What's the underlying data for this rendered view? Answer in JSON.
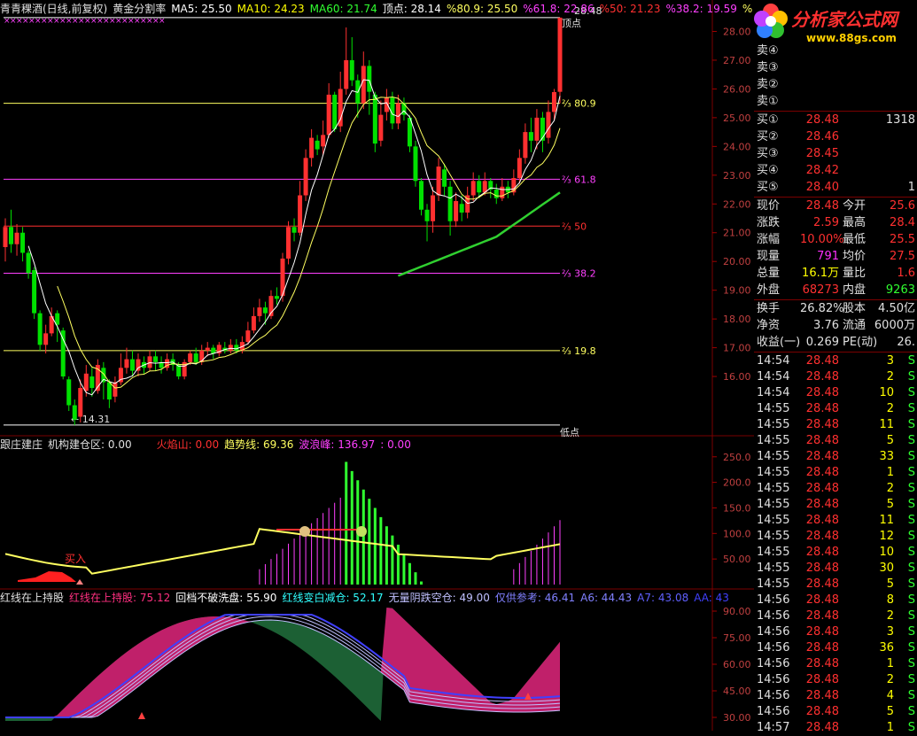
{
  "header": {
    "stock_name": "青青稞酒(日线,前复权)",
    "indicator": "黄金分割率",
    "ma5": "MA5: 25.50",
    "ma10": "MA10: 24.23",
    "ma60": "MA60: 21.74",
    "top": "顶点: 28.14",
    "p809": "%80.9: 25.50",
    "p618": "%61.8: 22.86",
    "p50": "%50: 21.23",
    "p382": "%38.2: 19.59",
    "pct": "%"
  },
  "price_labels": {
    "top_value": "28.48",
    "top_label": "顶点",
    "low_value": "14.31",
    "low_label": "低点",
    "lv809": "80.9",
    "lv618": "61.8",
    "lv50": "50",
    "lv382": "38.2",
    "lv198": "19.8"
  },
  "ind1": {
    "title": "跟庄建庄",
    "jgc": "机构建仓区: 0.00",
    "hys": "火焰山: 0.00",
    "qsx": "趋势线: 69.36",
    "blf": "波浪峰: 136.97",
    "tail": ": 0.00",
    "buy": "买入"
  },
  "ind2": {
    "a": "红线在上持股",
    "b": "红线在上持股: 75.12",
    "c": "回档不破洗盘: 55.90",
    "d": "红线变白减仓: 52.17",
    "e": "无量阴跌空仓: 49.00",
    "f": "仅供参考: 46.41",
    "g": "A6: 44.43",
    "h": "A7: 43.08",
    "i": "AA: 43"
  },
  "logo": {
    "title": "分析家公式网",
    "url": "www.88gs.com"
  },
  "quote": {
    "sell": [
      "卖④",
      "卖③",
      "卖②",
      "卖①"
    ],
    "buy": [
      {
        "label": "买①",
        "price": "28.48",
        "vol": "1318"
      },
      {
        "label": "买②",
        "price": "28.46",
        "vol": ""
      },
      {
        "label": "买③",
        "price": "28.45",
        "vol": ""
      },
      {
        "label": "买④",
        "price": "28.42",
        "vol": ""
      },
      {
        "label": "买⑤",
        "price": "28.40",
        "vol": "1"
      }
    ],
    "stats": [
      {
        "l1": "现价",
        "v1": "28.48",
        "l2": "今开",
        "v2": "25.6",
        "c1": "#ff3030",
        "c2": "#ff3030"
      },
      {
        "l1": "涨跌",
        "v1": "2.59",
        "l2": "最高",
        "v2": "28.4",
        "c1": "#ff3030",
        "c2": "#ff3030"
      },
      {
        "l1": "涨幅",
        "v1": "10.00%",
        "l2": "最低",
        "v2": "25.5",
        "c1": "#ff3030",
        "c2": "#ff3030"
      },
      {
        "l1": "现量",
        "v1": "791",
        "l2": "均价",
        "v2": "27.5",
        "c1": "#ff30ff",
        "c2": "#ff3030"
      },
      {
        "l1": "总量",
        "v1": "16.1万",
        "l2": "量比",
        "v2": "1.6",
        "c1": "#ffff00",
        "c2": "#ff3030"
      },
      {
        "l1": "外盘",
        "v1": "68273",
        "l2": "内盘",
        "v2": "9263",
        "c1": "#ff3030",
        "c2": "#30ff30"
      }
    ],
    "extra": [
      {
        "l1": "换手",
        "v1": "26.82%",
        "l2": "股本",
        "v2": "4.50亿"
      },
      {
        "l1": "净资",
        "v1": "3.76",
        "l2": "流通",
        "v2": "6000万"
      },
      {
        "l1": "收益(一)",
        "v1": "0.269",
        "l2": "PE(动)",
        "v2": "26."
      }
    ]
  },
  "ticks": [
    {
      "t": "14:54",
      "p": "28.48",
      "v": "3",
      "s": "S"
    },
    {
      "t": "14:54",
      "p": "28.48",
      "v": "2",
      "s": "S"
    },
    {
      "t": "14:54",
      "p": "28.48",
      "v": "10",
      "s": "S"
    },
    {
      "t": "14:55",
      "p": "28.48",
      "v": "2",
      "s": "S"
    },
    {
      "t": "14:55",
      "p": "28.48",
      "v": "11",
      "s": "S"
    },
    {
      "t": "14:55",
      "p": "28.48",
      "v": "5",
      "s": "S"
    },
    {
      "t": "14:55",
      "p": "28.48",
      "v": "33",
      "s": "S"
    },
    {
      "t": "14:55",
      "p": "28.48",
      "v": "1",
      "s": "S"
    },
    {
      "t": "14:55",
      "p": "28.48",
      "v": "2",
      "s": "S"
    },
    {
      "t": "14:55",
      "p": "28.48",
      "v": "5",
      "s": "S"
    },
    {
      "t": "14:55",
      "p": "28.48",
      "v": "11",
      "s": "S"
    },
    {
      "t": "14:55",
      "p": "28.48",
      "v": "12",
      "s": "S"
    },
    {
      "t": "14:55",
      "p": "28.48",
      "v": "10",
      "s": "S"
    },
    {
      "t": "14:55",
      "p": "28.48",
      "v": "30",
      "s": "S"
    },
    {
      "t": "14:55",
      "p": "28.48",
      "v": "5",
      "s": "S"
    },
    {
      "t": "14:56",
      "p": "28.48",
      "v": "8",
      "s": "S"
    },
    {
      "t": "14:56",
      "p": "28.48",
      "v": "2",
      "s": "S"
    },
    {
      "t": "14:56",
      "p": "28.48",
      "v": "3",
      "s": "S"
    },
    {
      "t": "14:56",
      "p": "28.48",
      "v": "36",
      "s": "S"
    },
    {
      "t": "14:56",
      "p": "28.48",
      "v": "1",
      "s": "S"
    },
    {
      "t": "14:56",
      "p": "28.48",
      "v": "2",
      "s": "S"
    },
    {
      "t": "14:56",
      "p": "28.48",
      "v": "4",
      "s": "S"
    },
    {
      "t": "14:56",
      "p": "28.48",
      "v": "5",
      "s": "S"
    },
    {
      "t": "14:57",
      "p": "28.48",
      "v": "1",
      "s": "S"
    }
  ],
  "chart_data": [
    {
      "type": "candlestick",
      "title": "青青稞酒(日线,前复权)",
      "y_ticks": [
        "28.00",
        "27.00",
        "26.00",
        "25.00",
        "24.00",
        "23.00",
        "22.00",
        "21.00",
        "20.00",
        "19.00",
        "18.00",
        "17.00",
        "16.00"
      ],
      "ylim": [
        14.0,
        28.6
      ],
      "levels": [
        {
          "name": "顶点",
          "value": 28.48,
          "color": "#ffffff"
        },
        {
          "name": "80.9",
          "value": 25.5,
          "color": "#ffff60"
        },
        {
          "name": "61.8",
          "value": 22.86,
          "color": "#ff40ff"
        },
        {
          "name": "50",
          "value": 21.23,
          "color": "#ff3030"
        },
        {
          "name": "38.2",
          "value": 19.59,
          "color": "#ff40ff"
        },
        {
          "name": "19.8",
          "value": 16.9,
          "color": "#ffff60"
        },
        {
          "name": "低点",
          "value": 14.31,
          "color": "#ffffff"
        }
      ],
      "candles": [
        [
          20.5,
          21.2,
          21.5,
          20.0
        ],
        [
          21.2,
          20.6,
          21.8,
          20.3
        ],
        [
          20.6,
          21.0,
          21.3,
          20.2
        ],
        [
          21.0,
          20.3,
          21.2,
          20.0
        ],
        [
          20.3,
          19.6,
          20.4,
          19.4
        ],
        [
          19.7,
          18.2,
          19.8,
          18.0
        ],
        [
          18.2,
          17.1,
          18.3,
          16.9
        ],
        [
          17.1,
          17.5,
          17.8,
          16.8
        ],
        [
          17.5,
          18.1,
          18.4,
          17.4
        ],
        [
          18.2,
          17.8,
          18.3,
          17.2
        ],
        [
          17.6,
          16.0,
          17.7,
          15.9
        ],
        [
          15.9,
          15.0,
          16.0,
          14.8
        ],
        [
          15.0,
          14.5,
          15.2,
          14.31
        ],
        [
          14.6,
          15.6,
          15.9,
          14.4
        ],
        [
          15.5,
          16.1,
          16.4,
          15.3
        ],
        [
          16.0,
          15.6,
          16.3,
          15.3
        ],
        [
          15.5,
          16.4,
          16.6,
          15.4
        ],
        [
          16.3,
          15.8,
          16.5,
          15.2
        ],
        [
          15.8,
          15.2,
          15.9,
          14.9
        ],
        [
          15.3,
          15.8,
          16.0,
          15.1
        ],
        [
          15.8,
          16.3,
          16.8,
          15.7
        ],
        [
          16.3,
          16.6,
          17.0,
          16.1
        ],
        [
          16.6,
          16.2,
          16.9,
          16.0
        ],
        [
          16.2,
          16.6,
          16.8,
          16.0
        ],
        [
          16.5,
          16.3,
          16.7,
          16.1
        ],
        [
          16.3,
          16.7,
          16.9,
          16.2
        ],
        [
          16.7,
          16.5,
          16.9,
          16.2
        ],
        [
          16.5,
          16.3,
          16.7,
          16.1
        ],
        [
          16.3,
          16.6,
          16.8,
          16.2
        ],
        [
          16.6,
          16.4,
          16.8,
          16.2
        ],
        [
          16.4,
          16.0,
          16.5,
          15.9
        ],
        [
          16.0,
          16.5,
          16.6,
          15.9
        ],
        [
          16.5,
          16.8,
          16.9,
          16.4
        ],
        [
          16.8,
          16.5,
          17.0,
          16.4
        ],
        [
          16.5,
          16.9,
          17.1,
          16.4
        ],
        [
          16.9,
          17.0,
          17.2,
          16.7
        ],
        [
          17.0,
          16.8,
          17.1,
          16.6
        ],
        [
          16.8,
          17.1,
          17.2,
          16.7
        ],
        [
          17.0,
          16.9,
          17.2,
          16.8
        ],
        [
          16.9,
          17.1,
          17.3,
          16.8
        ],
        [
          17.1,
          16.9,
          17.3,
          16.8
        ],
        [
          16.9,
          17.2,
          17.4,
          16.8
        ],
        [
          17.2,
          17.6,
          17.9,
          17.1
        ],
        [
          17.6,
          18.1,
          18.4,
          17.5
        ],
        [
          18.1,
          18.4,
          18.7,
          17.9
        ],
        [
          18.4,
          18.2,
          18.6,
          17.8
        ],
        [
          18.1,
          18.8,
          19.0,
          18.0
        ],
        [
          18.8,
          18.7,
          19.1,
          18.5
        ],
        [
          18.8,
          20.1,
          20.3,
          18.6
        ],
        [
          20.1,
          21.2,
          21.4,
          19.9
        ],
        [
          21.2,
          21.0,
          21.5,
          20.7
        ],
        [
          21.0,
          22.3,
          22.8,
          20.9
        ],
        [
          22.3,
          23.6,
          23.9,
          22.1
        ],
        [
          23.6,
          24.3,
          24.6,
          23.3
        ],
        [
          24.2,
          23.9,
          24.4,
          23.7
        ],
        [
          24.0,
          24.4,
          24.9,
          23.7
        ],
        [
          24.4,
          25.8,
          26.2,
          24.3
        ],
        [
          25.8,
          24.6,
          25.9,
          24.5
        ],
        [
          24.7,
          26.0,
          26.6,
          24.5
        ],
        [
          26.0,
          27.0,
          28.14,
          25.8
        ],
        [
          27.0,
          26.3,
          27.8,
          26.1
        ],
        [
          26.3,
          25.5,
          26.5,
          25.0
        ],
        [
          25.5,
          26.8,
          27.3,
          25.3
        ],
        [
          26.8,
          25.9,
          27.0,
          25.1
        ],
        [
          25.8,
          24.1,
          25.9,
          23.8
        ],
        [
          24.2,
          25.1,
          25.6,
          24.0
        ],
        [
          25.2,
          25.7,
          26.0,
          24.9
        ],
        [
          25.7,
          24.8,
          25.9,
          24.6
        ],
        [
          24.8,
          25.5,
          25.8,
          24.6
        ],
        [
          25.5,
          25.1,
          25.7,
          24.9
        ],
        [
          25.0,
          24.0,
          25.1,
          23.8
        ],
        [
          24.0,
          22.8,
          24.2,
          22.6
        ],
        [
          22.8,
          21.8,
          22.9,
          21.6
        ],
        [
          21.8,
          21.4,
          22.0,
          20.7
        ],
        [
          21.4,
          22.3,
          22.6,
          21.0
        ],
        [
          22.3,
          23.3,
          23.6,
          22.1
        ],
        [
          23.2,
          22.6,
          23.4,
          22.3
        ],
        [
          22.6,
          21.4,
          22.8,
          20.9
        ],
        [
          21.4,
          22.1,
          22.4,
          21.2
        ],
        [
          22.0,
          21.7,
          22.3,
          21.4
        ],
        [
          21.7,
          22.3,
          22.6,
          21.5
        ],
        [
          22.3,
          22.8,
          23.1,
          22.1
        ],
        [
          22.8,
          22.4,
          23.0,
          22.2
        ],
        [
          22.4,
          22.8,
          23.1,
          22.3
        ],
        [
          22.8,
          22.5,
          22.9,
          22.2
        ],
        [
          22.5,
          22.2,
          22.7,
          22.0
        ],
        [
          22.2,
          22.6,
          22.9,
          22.1
        ],
        [
          22.6,
          22.4,
          22.8,
          22.2
        ],
        [
          22.4,
          22.9,
          23.2,
          22.3
        ],
        [
          22.9,
          23.6,
          23.9,
          22.7
        ],
        [
          23.6,
          24.5,
          24.8,
          23.4
        ],
        [
          24.5,
          24.2,
          25.0,
          23.8
        ],
        [
          24.2,
          25.0,
          25.3,
          23.9
        ],
        [
          25.0,
          24.2,
          25.2,
          23.8
        ],
        [
          24.3,
          25.2,
          25.6,
          24.1
        ],
        [
          25.2,
          25.89,
          26.0,
          24.9
        ],
        [
          25.9,
          28.48,
          28.48,
          25.5
        ]
      ]
    },
    {
      "type": "bar",
      "title": "跟庄建庄",
      "y_ticks": [
        "250.0",
        "200.0",
        "150.0",
        "100.0",
        "50.00"
      ],
      "ylim": [
        0,
        260
      ]
    },
    {
      "type": "area",
      "title": "红线在上持股",
      "y_ticks": [
        "90.00",
        "75.00",
        "60.00",
        "45.00",
        "30.00"
      ],
      "ylim": [
        25,
        95
      ]
    }
  ]
}
